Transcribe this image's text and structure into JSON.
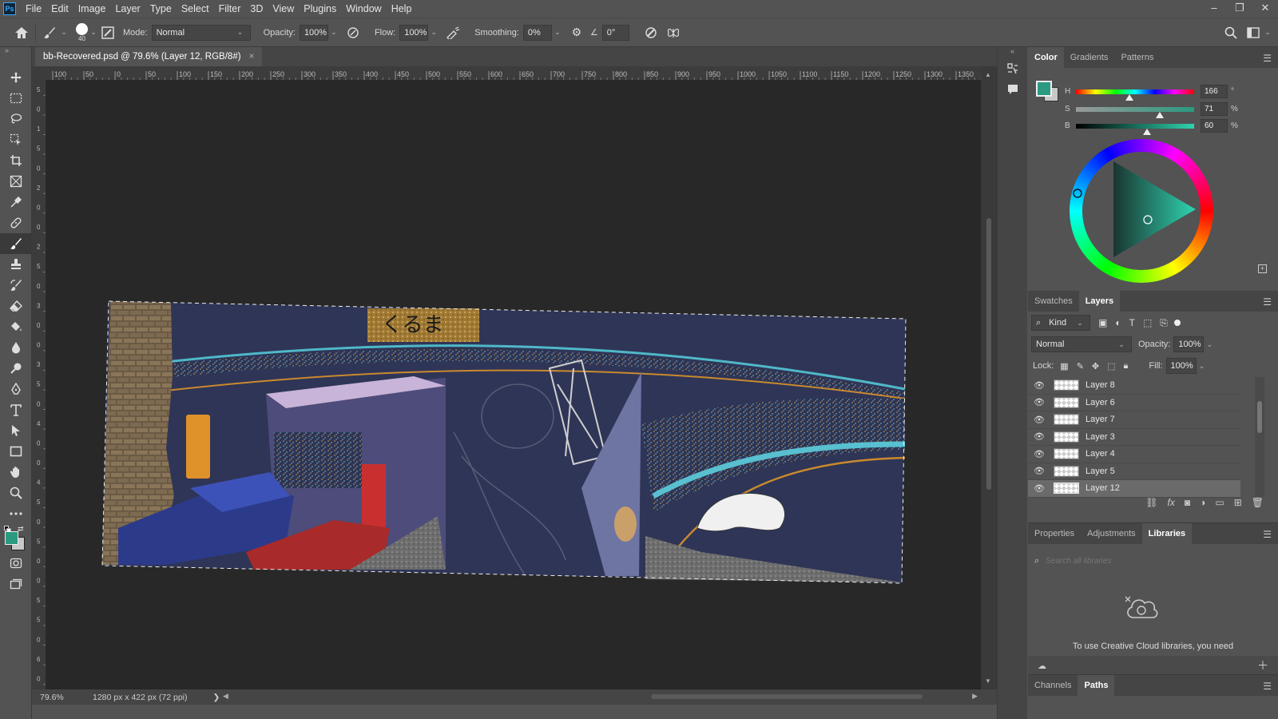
{
  "app": {
    "logo": "Ps"
  },
  "menu": [
    "File",
    "Edit",
    "Image",
    "Layer",
    "Type",
    "Select",
    "Filter",
    "3D",
    "View",
    "Plugins",
    "Window",
    "Help"
  ],
  "window_controls": [
    "–",
    "❐",
    "✕"
  ],
  "options": {
    "brush_size": "40",
    "mode_label": "Mode:",
    "mode_value": "Normal",
    "opacity_label": "Opacity:",
    "opacity_value": "100%",
    "flow_label": "Flow:",
    "flow_value": "100%",
    "smoothing_label": "Smoothing:",
    "smoothing_value": "0%",
    "angle_value": "0°"
  },
  "document": {
    "tab_title": "bb-Recovered.psd @ 79.6% (Layer 12, RGB/8#)",
    "close": "×"
  },
  "rulers": {
    "top_ticks": [
      "100",
      "50",
      "0",
      "50",
      "100",
      "150",
      "200",
      "250",
      "300",
      "350",
      "400",
      "450",
      "500",
      "550",
      "600",
      "650",
      "700",
      "750",
      "800",
      "850",
      "900",
      "950",
      "1000",
      "1050",
      "1100",
      "1150",
      "1200",
      "1250",
      "1300",
      "1350"
    ],
    "left_ticks": [
      "5",
      "0",
      "1",
      "5",
      "0",
      "2",
      "0",
      "0",
      "2",
      "5",
      "0",
      "3",
      "0",
      "0",
      "3",
      "5",
      "0",
      "4",
      "0",
      "0",
      "4",
      "5",
      "0",
      "5",
      "0",
      "0",
      "5",
      "5",
      "0",
      "6",
      "0"
    ]
  },
  "status": {
    "zoom": "79.6%",
    "doc_info": "1280 px x 422 px (72 ppi)",
    "arrow": "❯"
  },
  "color_panel": {
    "tabs": [
      "Color",
      "Gradients",
      "Patterns"
    ],
    "active_tab": "Color",
    "foreground_color": "#2a9a80",
    "background_color": "#c8c8c8",
    "h_label": "H",
    "h_value": "166",
    "h_unit": "°",
    "s_label": "S",
    "s_value": "71",
    "s_unit": "%",
    "b_label": "B",
    "b_value": "60",
    "b_unit": "%"
  },
  "layers_panel": {
    "tabs": [
      "Swatches",
      "Layers"
    ],
    "active_tab": "Layers",
    "filter_label": "Kind",
    "blend_mode": "Normal",
    "opacity_label": "Opacity:",
    "opacity_value": "100%",
    "lock_label": "Lock:",
    "fill_label": "Fill:",
    "fill_value": "100%",
    "layers": [
      {
        "name": "Layer 8"
      },
      {
        "name": "Layer 6"
      },
      {
        "name": "Layer 7"
      },
      {
        "name": "Layer 3"
      },
      {
        "name": "Layer 4"
      },
      {
        "name": "Layer 5"
      },
      {
        "name": "Layer 12"
      }
    ],
    "selected_layer": "Layer 12"
  },
  "libraries_panel": {
    "tabs": [
      "Properties",
      "Adjustments",
      "Libraries"
    ],
    "active_tab": "Libraries",
    "search_placeholder": "Search all libraries",
    "message": "To use Creative Cloud libraries, you need"
  },
  "bottom_panel": {
    "tabs": [
      "Channels",
      "Paths"
    ],
    "active_tab": "Paths"
  }
}
